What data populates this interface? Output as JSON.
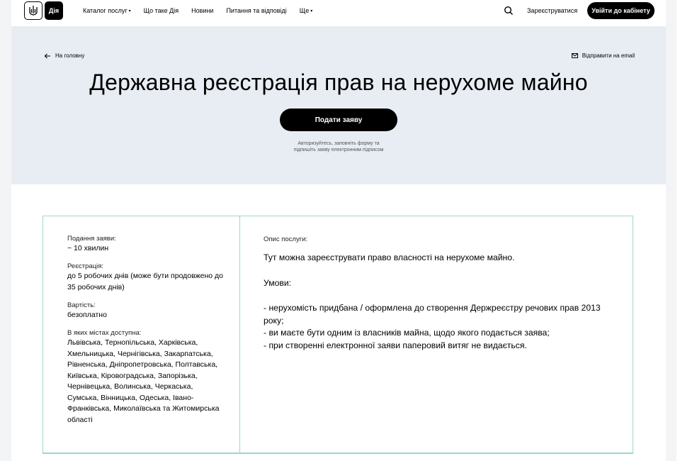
{
  "header": {
    "logo_text": "Дія",
    "nav": [
      {
        "label": "Каталог послуг",
        "dropdown": true
      },
      {
        "label": "Що таке Дія",
        "dropdown": false
      },
      {
        "label": "Новини",
        "dropdown": false
      },
      {
        "label": "Питання та відповіді",
        "dropdown": false
      },
      {
        "label": "Ще",
        "dropdown": true
      }
    ],
    "register": "Зареєструватися",
    "login": "Увійти до кабінету"
  },
  "hero": {
    "back": "На головну",
    "email": "Відправити на email",
    "title": "Державна реєстрація прав на нерухоме майно",
    "apply": "Подати заяву",
    "hint_line1": "Авторизуйтесь, заповніть форму та",
    "hint_line2": "підпишіть заяву електронним підписом"
  },
  "info": {
    "submission_label": "Подання заяви:",
    "submission_value": "~ 10 хвилин",
    "registration_label": "Реєстрація:",
    "registration_value": "до 5 робочих днів (може бути продовжено до 35 робочих днів)",
    "cost_label": "Вартість:",
    "cost_value": "безоплатно",
    "cities_label": "В яких містах доступна:",
    "cities_value": "Львівська, Тернопільська, Харківська, Хмельницька, Чернігівська, Закарпатська, Рівненська, Дніпропетровська, Полтавська, Київська, Кіровоградська, Запорізька, Чернівецька, Волинська, Черкаська, Сумська, Вінницька, Одеська, Івано-Франківська, Миколаївська та Житомирська області"
  },
  "description": {
    "label": "Опис послуги:",
    "intro": "Тут можна зареєструвати право власності на нерухоме майно.",
    "conditions_title": "Умови:",
    "conditions": [
      "- нерухомість придбана / оформлена до створення Держреєстру речових прав 2013 року;",
      "- ви маєте бути одним із власників майна, щодо якого подається заява;",
      "- при створенні електронної заяви паперовий витяг не видається."
    ]
  }
}
